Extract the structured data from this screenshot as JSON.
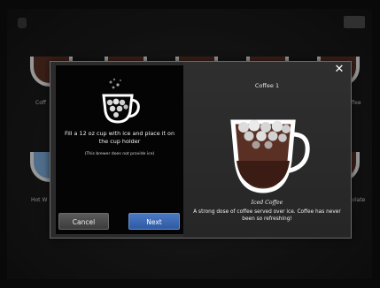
{
  "background": {
    "top_button_label": "",
    "labels": [
      "Coff",
      "Hot W",
      "ffee",
      "colate"
    ]
  },
  "modal": {
    "close_icon": "close-icon",
    "step": {
      "instruction": "Fill a 12 oz cup with ice and place it on the cup holder",
      "note": "(This brewer does not provide ice)",
      "icon": "iced-cup-icon"
    },
    "cancel_label": "Cancel",
    "next_label": "Next",
    "coffee": {
      "title": "Coffee 1",
      "name": "Iced Coffee",
      "description": "A strong dose of coffee served over ice. Coffee has never been so refreshing!",
      "icon": "iced-coffee-cup-icon"
    }
  },
  "colors": {
    "next_button": "#2f5aa3",
    "coffee": "#5a3024",
    "ice": "#dcdcdc",
    "panel": "#040404"
  }
}
